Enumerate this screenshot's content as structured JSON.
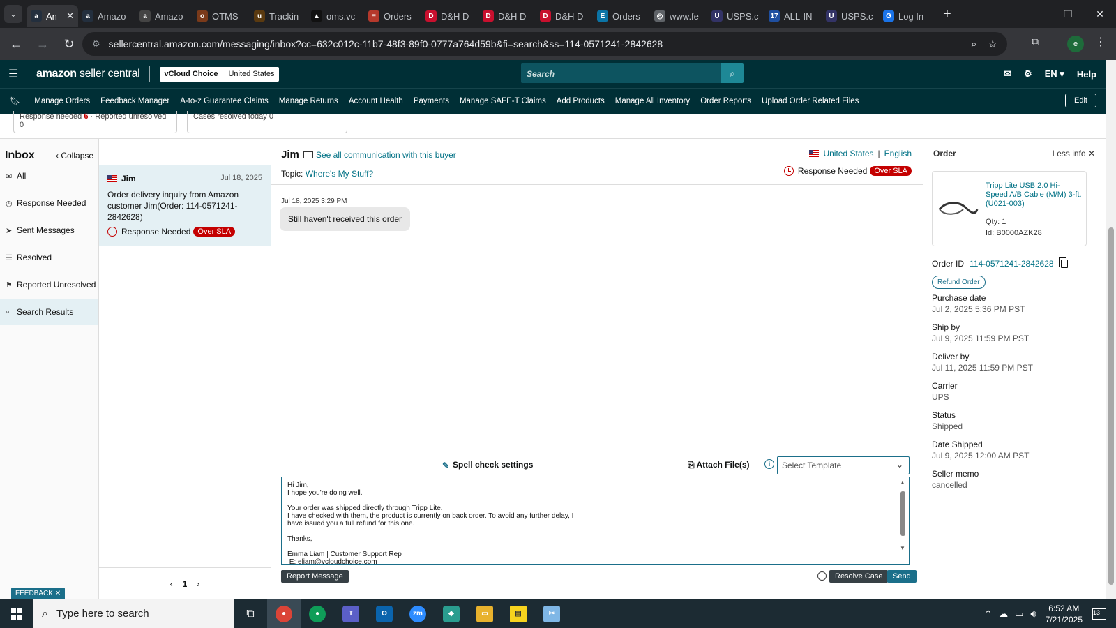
{
  "browser": {
    "tabs": [
      {
        "title": "An",
        "icon": "amazon-icon",
        "color": "#232f3e",
        "glyph": "a",
        "active": true
      },
      {
        "title": "Amazo",
        "icon": "amazon-icon",
        "color": "#232f3e",
        "glyph": "a"
      },
      {
        "title": "Amazo",
        "icon": "amazon-icon",
        "color": "#444",
        "glyph": "a"
      },
      {
        "title": "OTMS",
        "icon": "otms-icon",
        "color": "#7a3a1a",
        "glyph": "o"
      },
      {
        "title": "Trackin",
        "icon": "ups-icon",
        "color": "#5a3a10",
        "glyph": "u"
      },
      {
        "title": "oms.vc",
        "icon": "oms-icon",
        "color": "#111",
        "glyph": "▲"
      },
      {
        "title": "Orders",
        "icon": "orders-icon",
        "color": "#b5392c",
        "glyph": "≡"
      },
      {
        "title": "D&H D",
        "icon": "dh-icon",
        "color": "#c8102e",
        "glyph": "D"
      },
      {
        "title": "D&H D",
        "icon": "dh-icon",
        "color": "#c8102e",
        "glyph": "D"
      },
      {
        "title": "D&H D",
        "icon": "dh-icon",
        "color": "#c8102e",
        "glyph": "D"
      },
      {
        "title": "Orders",
        "icon": "ec-icon",
        "color": "#0b74a6",
        "glyph": "E"
      },
      {
        "title": "www.fe",
        "icon": "globe-icon",
        "color": "#5f6368",
        "glyph": "◎"
      },
      {
        "title": "USPS.c",
        "icon": "usps-icon",
        "color": "#333366",
        "glyph": "U"
      },
      {
        "title": "ALL-IN",
        "icon": "17track-icon",
        "color": "#1f4fa0",
        "glyph": "17"
      },
      {
        "title": "USPS.c",
        "icon": "usps-icon",
        "color": "#333366",
        "glyph": "U"
      },
      {
        "title": "Log In",
        "icon": "login-icon",
        "color": "#1a73e8",
        "glyph": "G"
      }
    ],
    "url": "sellercentral.amazon.com/messaging/inbox?cc=632c012c-11b7-48f3-89f0-0777a764d59b&fi=search&ss=114-0571241-2842628",
    "profile_initial": "e"
  },
  "header": {
    "logo_main": "amazon",
    "logo_sub": "seller central",
    "account_name": "vCloud Choice",
    "marketplace": "United States",
    "search_placeholder": "Search",
    "language": "EN",
    "help": "Help"
  },
  "nav": {
    "items": [
      "Manage Orders",
      "Feedback Manager",
      "A-to-z Guarantee Claims",
      "Manage Returns",
      "Account Health",
      "Payments",
      "Manage SAFE-T Claims",
      "Add Products",
      "Manage All Inventory",
      "Order Reports",
      "Upload Order Related Files"
    ],
    "edit": "Edit"
  },
  "summary": {
    "response_needed_label": "Response needed",
    "response_needed_count": "6",
    "reported_unresolved": "Reported unresolved 0",
    "cases_resolved": "Cases resolved today 0"
  },
  "inbox": {
    "title": "Inbox",
    "collapse": "Collapse",
    "items": [
      {
        "label": "All",
        "icon": "mail-icon"
      },
      {
        "label": "Response Needed",
        "icon": "clock-icon"
      },
      {
        "label": "Sent Messages",
        "icon": "send-icon"
      },
      {
        "label": "Resolved",
        "icon": "check-list-icon"
      },
      {
        "label": "Reported Unresolved",
        "icon": "report-user-icon"
      },
      {
        "label": "Search Results",
        "icon": "search-icon"
      }
    ]
  },
  "conversation": {
    "name": "Jim",
    "date": "Jul 18, 2025",
    "subject": "Order delivery inquiry from Amazon customer Jim(Order: 114-0571241-2842628)",
    "status": "Response Needed",
    "sla": "Over SLA",
    "page": "1"
  },
  "thread": {
    "buyer": "Jim",
    "see_all": "See all communication with this buyer",
    "topic_label": "Topic:",
    "topic": "Where's My Stuff?",
    "country": "United States",
    "language": "English",
    "status": "Response Needed",
    "sla": "Over SLA",
    "message_time": "Jul 18, 2025 3:29 PM",
    "message": "Still haven't received this order",
    "spell_check": "Spell check settings",
    "attach": "Attach File(s)",
    "template_placeholder": "Select Template",
    "draft": "Hi Jim,\nI hope you're doing well.\n\nYour order was shipped directly through Tripp Lite.\nI have checked with them, the product is currently on back order. To avoid any further delay, I\nhave issued you a full refund for this one.\n\nThanks,\n\nEmma Liam | Customer Support Rep\n E: eliam@vcloudchoice.com",
    "report": "Report Message",
    "resolve": "Resolve Case",
    "send": "Send"
  },
  "order": {
    "title": "Order",
    "less_info": "Less info",
    "product_name": "Tripp Lite USB 2.0 Hi-Speed A/B Cable (M/M) 3-ft. (U021-003)",
    "qty": "Qty: 1",
    "id": "Id: B0000AZK28",
    "order_id_label": "Order ID",
    "order_id": "114-0571241-2842628",
    "refund": "Refund Order",
    "fields": [
      {
        "label": "Purchase date",
        "value": "Jul 2, 2025 5:36 PM PST"
      },
      {
        "label": "Ship by",
        "value": "Jul 9, 2025 11:59 PM PST"
      },
      {
        "label": "Deliver by",
        "value": "Jul 11, 2025 11:59 PM PST"
      },
      {
        "label": "Carrier",
        "value": "UPS"
      },
      {
        "label": "Status",
        "value": "Shipped"
      },
      {
        "label": "Date Shipped",
        "value": "Jul 9, 2025 12:00 AM PST"
      },
      {
        "label": "Seller memo",
        "value": "cancelled"
      }
    ]
  },
  "feedback": "FEEDBACK",
  "taskbar": {
    "search_placeholder": "Type here to search",
    "time": "6:52 AM",
    "date": "7/21/2025",
    "notifications": "13"
  }
}
